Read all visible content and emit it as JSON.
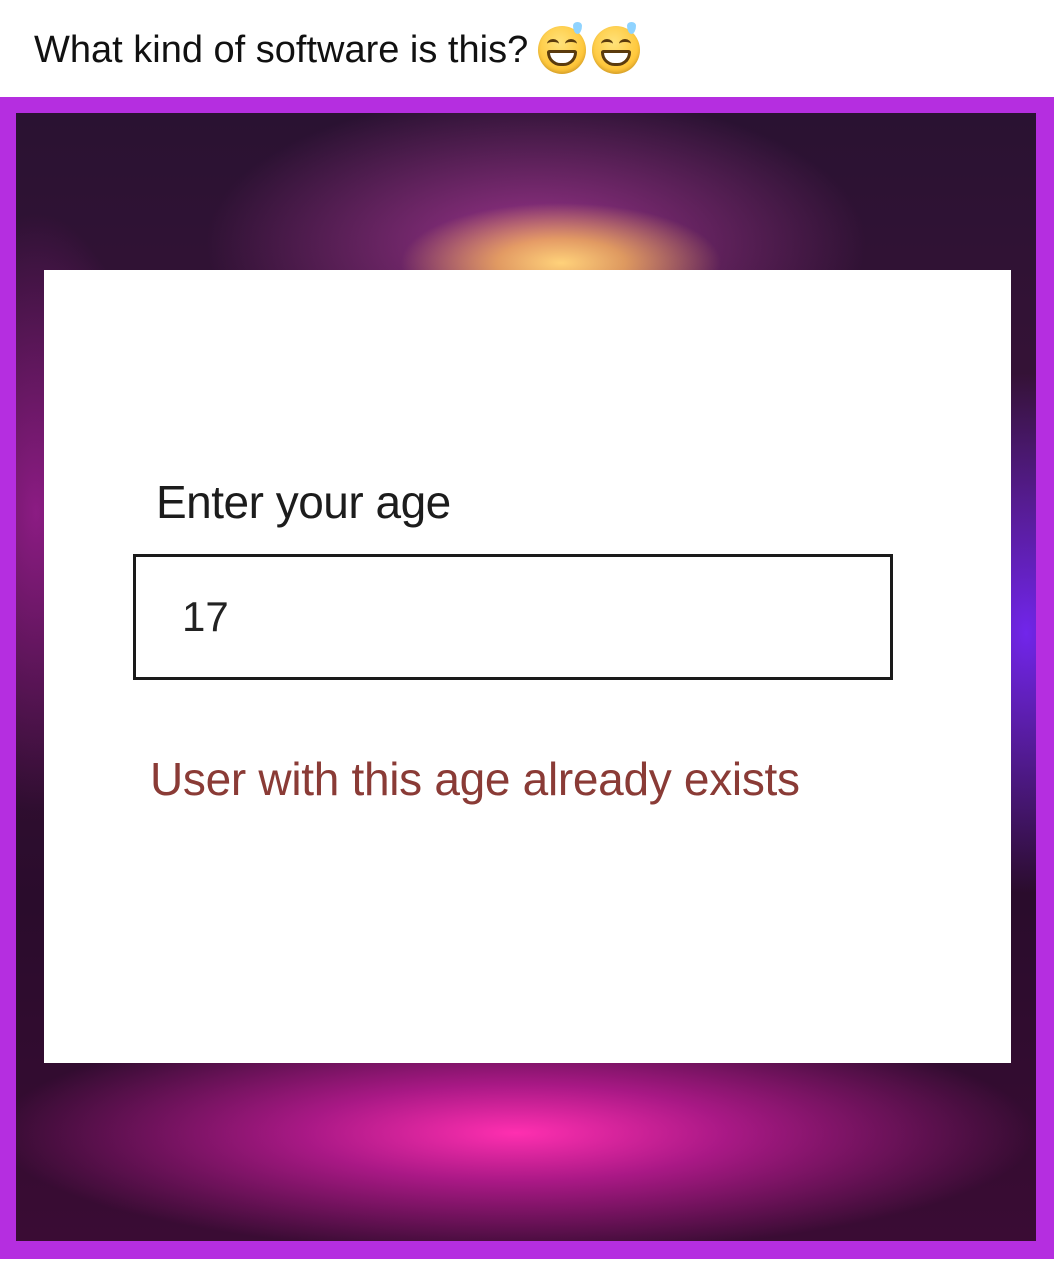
{
  "post": {
    "caption": "What kind of software is this?",
    "emojis": [
      "grinning-face-with-sweat",
      "grinning-face-with-sweat"
    ]
  },
  "dialog": {
    "label": "Enter your age",
    "input_value": "17",
    "error_message": "User with this age already exists"
  },
  "colors": {
    "frame_border": "#b52ee0",
    "error_text": "#8a3b36",
    "dialog_background": "#ffffff"
  }
}
